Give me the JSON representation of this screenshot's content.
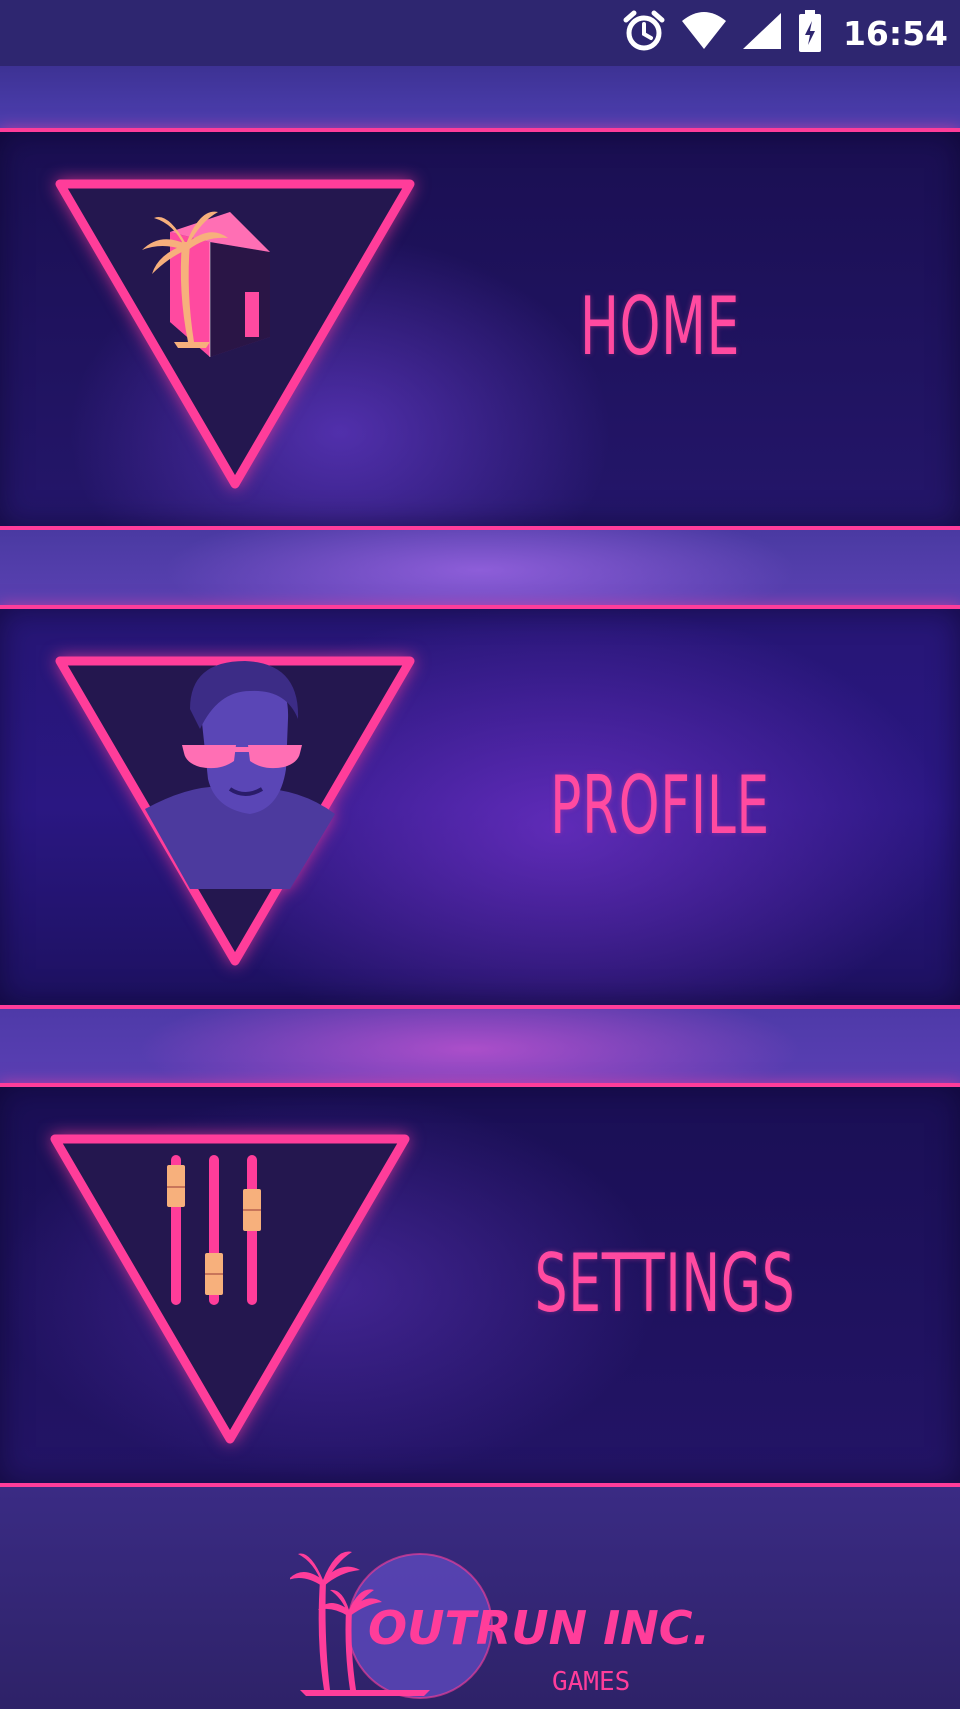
{
  "status_bar": {
    "time": "16:54",
    "icons": [
      "alarm-icon",
      "wifi-icon",
      "signal-icon",
      "battery-charging-icon"
    ]
  },
  "menu": {
    "items": [
      {
        "label": "HOME",
        "icon": "home-palm-icon"
      },
      {
        "label": "PROFILE",
        "icon": "profile-sunglasses-icon"
      },
      {
        "label": "SETTINGS",
        "icon": "sliders-icon"
      }
    ]
  },
  "footer": {
    "logo_text": "OUTRUN INC.",
    "logo_subtext": "GAMES",
    "logo_icon": "palm-sun-logo-icon"
  },
  "colors": {
    "neon_pink": "#ff3d9a",
    "panel_dark": "#1a0f52",
    "accent_peach": "#f7b07c"
  }
}
